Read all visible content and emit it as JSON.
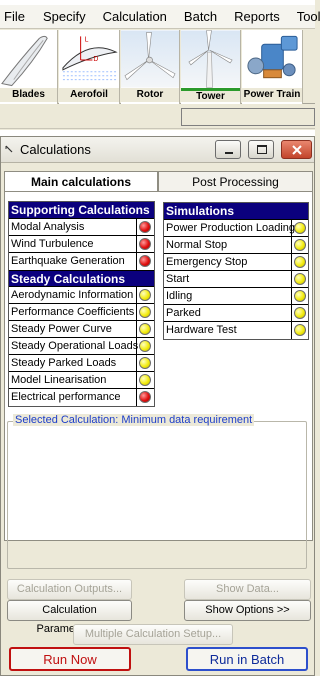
{
  "menu": [
    "File",
    "Specify",
    "Calculation",
    "Batch",
    "Reports",
    "Tools"
  ],
  "toolbar": [
    {
      "label": "Blades",
      "icon": "blade-icon"
    },
    {
      "label": "Aerofoil",
      "icon": "aerofoil-icon"
    },
    {
      "label": "Rotor",
      "icon": "rotor-icon"
    },
    {
      "label": "Tower",
      "icon": "tower-icon",
      "active": true
    },
    {
      "label": "Power Train",
      "icon": "power-train-icon"
    }
  ],
  "aerofoil_letters": {
    "l": "L",
    "d": "D"
  },
  "window": {
    "title": "Calculations"
  },
  "tabs": {
    "main": "Main calculations",
    "post": "Post Processing"
  },
  "supporting": {
    "header": "Supporting Calculations",
    "items": [
      {
        "label": "Modal Analysis",
        "status": "red"
      },
      {
        "label": "Wind Turbulence",
        "status": "red"
      },
      {
        "label": "Earthquake Generation",
        "status": "red"
      }
    ]
  },
  "steady": {
    "header": "Steady Calculations",
    "items": [
      {
        "label": "Aerodynamic Information",
        "status": "yellow"
      },
      {
        "label": "Performance Coefficients",
        "status": "yellow"
      },
      {
        "label": "Steady Power Curve",
        "status": "yellow"
      },
      {
        "label": "Steady Operational Loads",
        "status": "yellow"
      },
      {
        "label": "Steady Parked Loads",
        "status": "yellow"
      },
      {
        "label": "Model Linearisation",
        "status": "yellow"
      },
      {
        "label": "Electrical performance",
        "status": "red"
      }
    ]
  },
  "simulations": {
    "header": "Simulations",
    "items": [
      {
        "label": "Power Production Loading",
        "status": "yellow"
      },
      {
        "label": "Normal Stop",
        "status": "yellow"
      },
      {
        "label": "Emergency Stop",
        "status": "yellow"
      },
      {
        "label": "Start",
        "status": "yellow"
      },
      {
        "label": "Idling",
        "status": "yellow"
      },
      {
        "label": "Parked",
        "status": "yellow"
      },
      {
        "label": "Hardware Test",
        "status": "yellow"
      }
    ]
  },
  "selected_group": "Selected Calculation: Minimum data requirement",
  "buttons": {
    "calc_outputs": "Calculation Outputs...",
    "show_data": "Show Data...",
    "calc_params": "Calculation Parameters...",
    "show_options": "Show Options >>",
    "multi_setup": "Multiple Calculation Setup...",
    "run_now": "Run Now",
    "run_batch": "Run in Batch"
  },
  "colors": {
    "list_header": "#0b007e",
    "status_red": "#e01010",
    "status_yellow": "#f3ec10",
    "active_tab_marker": "#2b9a2b"
  }
}
